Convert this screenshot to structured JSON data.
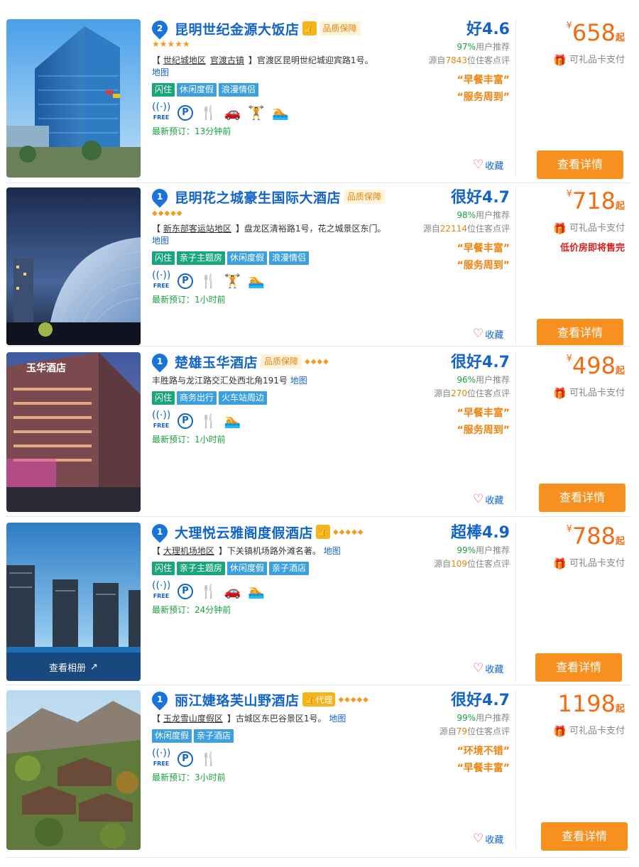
{
  "colors": {
    "brand_blue": "#1264c8",
    "orange": "#f7901e",
    "price": "#f26b12",
    "green": "#1aa040",
    "tag_green": "#1aa67c",
    "tag_blue": "#3b9fe0"
  },
  "hotels": [
    {
      "rank": "2",
      "name": "昆明世纪金源大饭店",
      "quality_badge": "品质保障",
      "stars": "★★★★★",
      "address": {
        "prefix": "【",
        "area1": "世纪城地区",
        "area2": "官渡古镇",
        "suffix": "】官渡区昆明世纪城迎宾路1号。",
        "map": "地图"
      },
      "tags": [
        "闪住",
        "休闲度假",
        "浪漫情侣"
      ],
      "latest": "最新预订：13分钟前",
      "score": "好4.6",
      "recommend_pct": "97%",
      "recommend_label": "用户推荐",
      "review_prefix": "源自",
      "review_count": "7843",
      "review_suffix": "位住客点评",
      "quotes": [
        "“早餐丰富”",
        "“服务周到”"
      ],
      "fav": "收藏",
      "yen": "¥",
      "price": "658",
      "qi": "起",
      "gift": "可礼品卡支付",
      "detail": "查看详情"
    },
    {
      "rank": "1",
      "name": "昆明花之城豪生国际大酒店",
      "quality_badge": "品质保障",
      "diamonds": "◆◆◆◆◆",
      "address": {
        "prefix": "【",
        "area1": "新东部客运站地区",
        "suffix": "】盘龙区清裕路1号，花之城景区东门。",
        "map": "地图"
      },
      "tags": [
        "闪住",
        "亲子主题房",
        "休闲度假",
        "浪漫情侣"
      ],
      "latest": "最新预订：1小时前",
      "score": "很好4.7",
      "recommend_pct": "98%",
      "recommend_label": "用户推荐",
      "review_prefix": "源自",
      "review_count": "22114",
      "review_suffix": "位住客点评",
      "quotes": [
        "“早餐丰富”",
        "“服务周到”"
      ],
      "fav": "收藏",
      "yen": "¥",
      "price": "718",
      "qi": "起",
      "gift": "可礼品卡支付",
      "low": "低价房即将售完",
      "detail": "查看详情"
    },
    {
      "rank": "1",
      "name": "楚雄玉华酒店",
      "quality_badge": "品质保障",
      "diamonds": "◆◆◆◆",
      "address": {
        "street": "丰胜路与龙江路交汇处西北角191号",
        "map": "地图"
      },
      "tags": [
        "闪住",
        "商务出行",
        "火车站周边"
      ],
      "latest": "最新预订：1小时前",
      "score": "很好4.7",
      "recommend_pct": "96%",
      "recommend_label": "用户推荐",
      "review_prefix": "源自",
      "review_count": "270",
      "review_suffix": "位住客点评",
      "quotes": [
        "“早餐丰富”",
        "“服务周到”"
      ],
      "photo_sign": "玉华酒店",
      "fav": "收藏",
      "yen": "¥",
      "price": "498",
      "qi": "起",
      "gift": "可礼品卡支付",
      "detail": "查看详情"
    },
    {
      "rank": "1",
      "name": "大理悦云雅阁度假酒店",
      "diamonds": "◆◆◆◆◆",
      "address": {
        "prefix": "【",
        "area1": "大理机场地区",
        "suffix": "】下关镇机场路外滩名著。",
        "map": "地图"
      },
      "tags": [
        "闪住",
        "亲子主题房",
        "休闲度假",
        "亲子酒店"
      ],
      "latest": "最新预订：24分钟前",
      "score": "超棒4.9",
      "recommend_pct": "99%",
      "recommend_label": "用户推荐",
      "review_prefix": "源自",
      "review_count": "109",
      "review_suffix": "位住客点评",
      "album": "查看相册",
      "fav": "收藏",
      "yen": "¥",
      "price": "788",
      "qi": "起",
      "gift": "可礼品卡支付",
      "detail": "查看详情"
    },
    {
      "rank": "1",
      "name": "丽江婕珞芙山野酒店",
      "agent": "代理",
      "diamonds": "◆◆◆◆◆",
      "address": {
        "prefix": "【",
        "area1": "玉龙雪山度假区",
        "suffix": "】古城区东巴谷景区1号。",
        "map": "地图"
      },
      "tags": [
        "休闲度假",
        "亲子酒店"
      ],
      "latest": "最新预订：3小时前",
      "score": "很好4.7",
      "recommend_pct": "99%",
      "recommend_label": "用户推荐",
      "review_prefix": "源自",
      "review_count": "79",
      "review_suffix": "位住客点评",
      "quotes": [
        "“环境不错”",
        "“早餐丰富”"
      ],
      "fav": "收藏",
      "price": "1198",
      "qi": "起",
      "gift": "可礼品卡支付",
      "detail": "查看详情"
    }
  ],
  "amenity_icons": [
    "wifi-icon",
    "parking-icon",
    "restaurant-icon",
    "car-service-icon",
    "gym-icon",
    "pool-icon"
  ],
  "wifi_label": "FREE"
}
